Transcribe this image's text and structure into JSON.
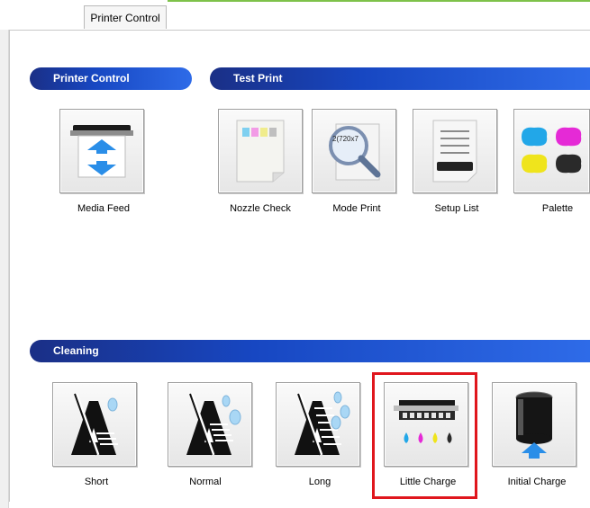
{
  "window": {
    "tab_label": "Printer Control"
  },
  "sections": {
    "printer_control": "Printer Control",
    "test_print": "Test Print",
    "cleaning": "Cleaning"
  },
  "buttons": {
    "media_feed": "Media Feed",
    "nozzle_check": "Nozzle Check",
    "mode_print": "Mode Print",
    "mode_print_icon_text": "2(720x7",
    "setup_list": "Setup List",
    "palette": "Palette",
    "short": "Short",
    "normal": "Normal",
    "long": "Long",
    "little_charge": "Little Charge",
    "initial_charge": "Initial Charge"
  },
  "colors": {
    "section_bar_start": "#1a2f86",
    "section_bar_end": "#2e6be8",
    "highlight": "#e0161d",
    "accent_green": "#7ec24a",
    "ink_cyan": "#22a7e8",
    "ink_magenta": "#e52ad6",
    "ink_yellow": "#efe41c",
    "ink_black": "#2a2a2a"
  }
}
